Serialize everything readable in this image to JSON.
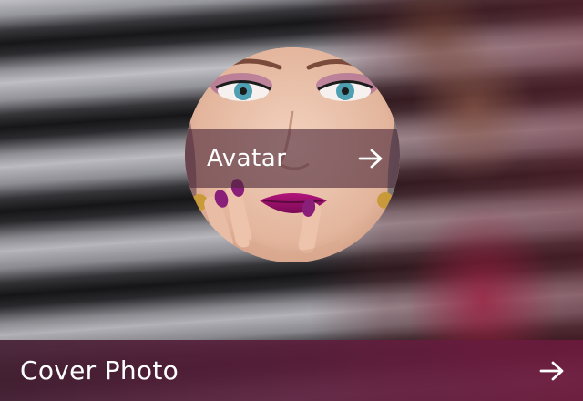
{
  "avatar": {
    "label": "Avatar",
    "arrow_icon": "arrow-right-icon"
  },
  "cover_photo": {
    "label": "Cover Photo",
    "arrow_icon": "arrow-right-icon"
  },
  "colors": {
    "overlay_bar": "#4e283a",
    "cover_bar": "#601e3e",
    "text": "#ffffff"
  }
}
